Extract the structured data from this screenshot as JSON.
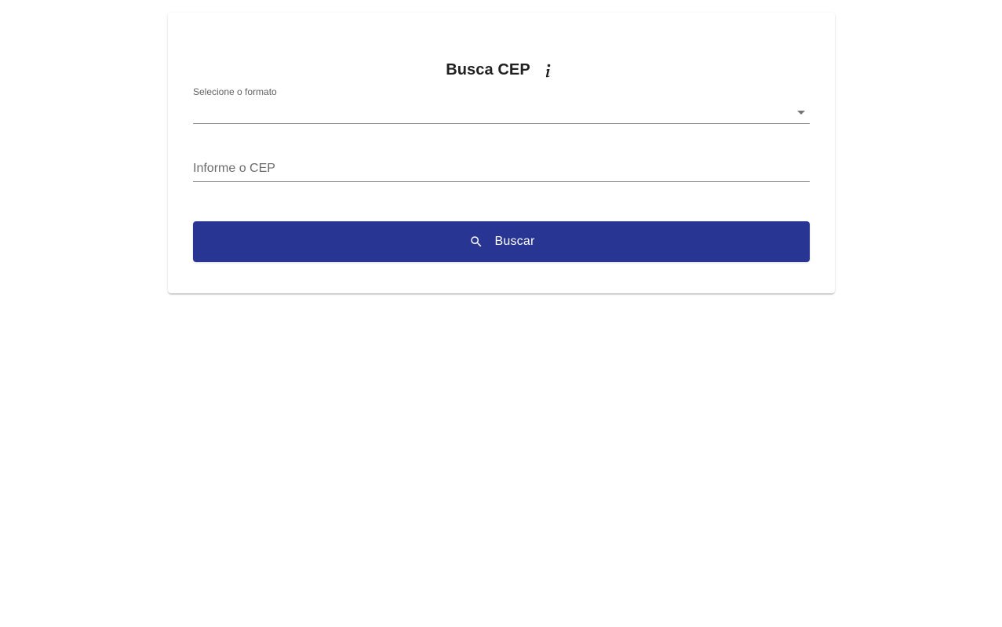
{
  "form": {
    "title": "Busca CEP",
    "format_select": {
      "label": "Selecione o formato",
      "value": ""
    },
    "cep_input": {
      "placeholder": "Informe o CEP",
      "value": ""
    },
    "search_button": {
      "label": "Buscar",
      "icon": "search-icon"
    },
    "info_icon": "info-icon"
  },
  "colors": {
    "primary": "#283593",
    "text": "#212121",
    "label": "#616161",
    "underline": "#8a8a8a"
  }
}
